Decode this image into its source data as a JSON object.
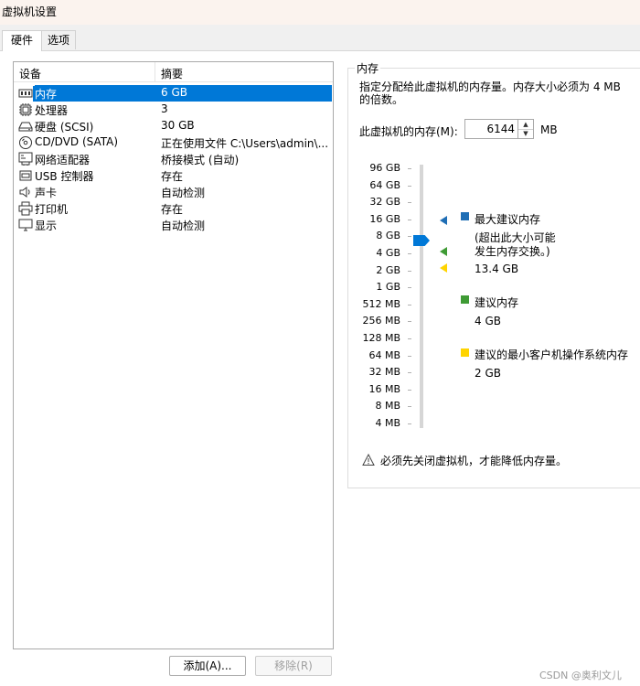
{
  "window": {
    "title": "虚拟机设置"
  },
  "tabs": [
    {
      "label": "硬件",
      "active": true
    },
    {
      "label": "选项",
      "active": false
    }
  ],
  "device_list": {
    "columns": {
      "device": "设备",
      "summary": "摘要"
    },
    "rows": [
      {
        "icon": "memory-icon",
        "name": "内存",
        "summary": "6 GB",
        "selected": true
      },
      {
        "icon": "cpu-icon",
        "name": "处理器",
        "summary": "3"
      },
      {
        "icon": "disk-icon",
        "name": "硬盘 (SCSI)",
        "summary": "30 GB"
      },
      {
        "icon": "cd-icon",
        "name": "CD/DVD (SATA)",
        "summary": "正在使用文件 C:\\Users\\admin\\..."
      },
      {
        "icon": "network-icon",
        "name": "网络适配器",
        "summary": "桥接模式 (自动)"
      },
      {
        "icon": "usb-icon",
        "name": "USB 控制器",
        "summary": "存在"
      },
      {
        "icon": "sound-icon",
        "name": "声卡",
        "summary": "自动检测"
      },
      {
        "icon": "printer-icon",
        "name": "打印机",
        "summary": "存在"
      },
      {
        "icon": "display-icon",
        "name": "显示",
        "summary": "自动检测"
      }
    ]
  },
  "buttons": {
    "add": "添加(A)...",
    "remove": "移除(R)"
  },
  "memory": {
    "group_title": "内存",
    "description": "指定分配给此虚拟机的内存量。内存大小必须为 4 MB 的倍数。",
    "label": "此虚拟机的内存(M):",
    "value": "6144",
    "unit": "MB",
    "scale_ticks": [
      "96 GB",
      "64 GB",
      "32 GB",
      "16 GB",
      "8 GB",
      "4 GB",
      "2 GB",
      "1 GB",
      "512 MB",
      "256 MB",
      "128 MB",
      "64 MB",
      "32 MB",
      "16 MB",
      "8 MB",
      "4 MB"
    ],
    "legend": {
      "max_title": "最大建议内存",
      "max_note_1": "(超出此大小可能",
      "max_note_2": "发生内存交换。)",
      "max_value": "13.4 GB",
      "rec_title": "建议内存",
      "rec_value": "4 GB",
      "min_title": "建议的最小客户机操作系统内存",
      "min_value": "2 GB"
    },
    "colors": {
      "max": "#1f6eb5",
      "recommended": "#3f9b35",
      "minimum": "#ffd400",
      "slider": "#0078d7"
    },
    "warning": "必须先关闭虚拟机，才能降低内存量。"
  },
  "watermark": "CSDN @奥利文儿"
}
